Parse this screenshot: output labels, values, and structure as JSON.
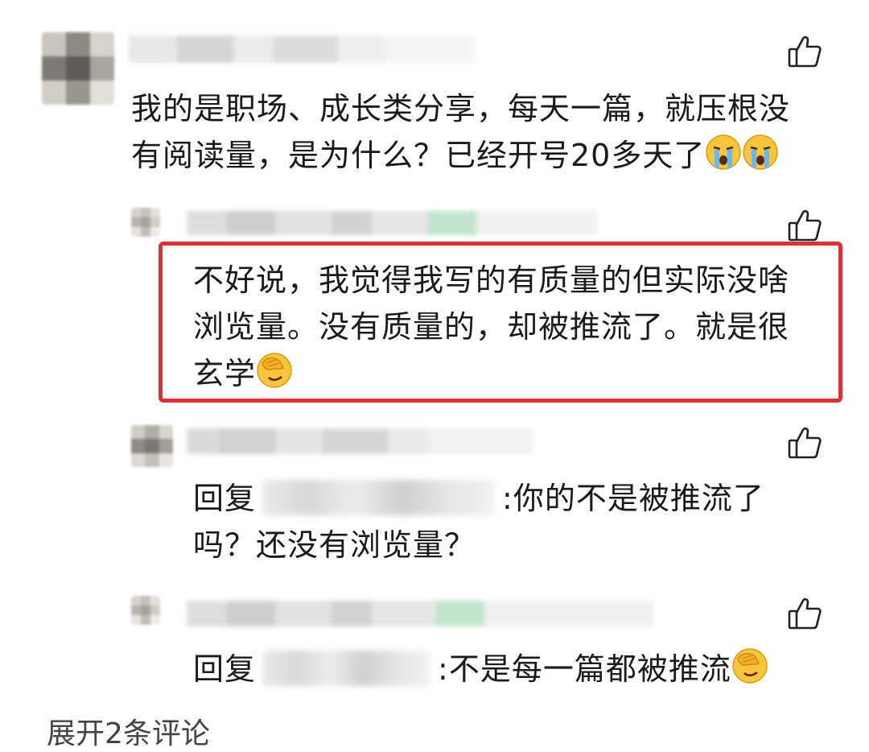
{
  "comments": [
    {
      "text_line1": "我的是职场、成长类分享，每天一篇，就压根没",
      "text_line2": "有阅读量，是为什么？已经开号20多天了",
      "trailing_emoji": [
        "crying-face-emoji",
        "crying-face-emoji"
      ]
    }
  ],
  "replies": [
    {
      "highlighted": true,
      "text_line1": "不好说，我觉得我写的有质量的但实际没啥",
      "text_line2": "浏览量。没有质量的，却被推流了。就是很",
      "text_line3": "玄学",
      "trailing_emoji": "facepalm-emoji"
    },
    {
      "prefix": "回复",
      "separator": ":",
      "text_line1_rest": "你的不是被推流了",
      "text_line2": "吗？还没有浏览量？"
    },
    {
      "prefix": "回复",
      "separator": ":",
      "text_line1_rest": "不是每一篇都被推流",
      "trailing_emoji": "facepalm-emoji"
    }
  ],
  "footer": {
    "more_replies": "展开2条评论"
  },
  "colors": {
    "highlight_border": "#d8333a",
    "text": "#1a1a1a",
    "icon": "#222222"
  }
}
